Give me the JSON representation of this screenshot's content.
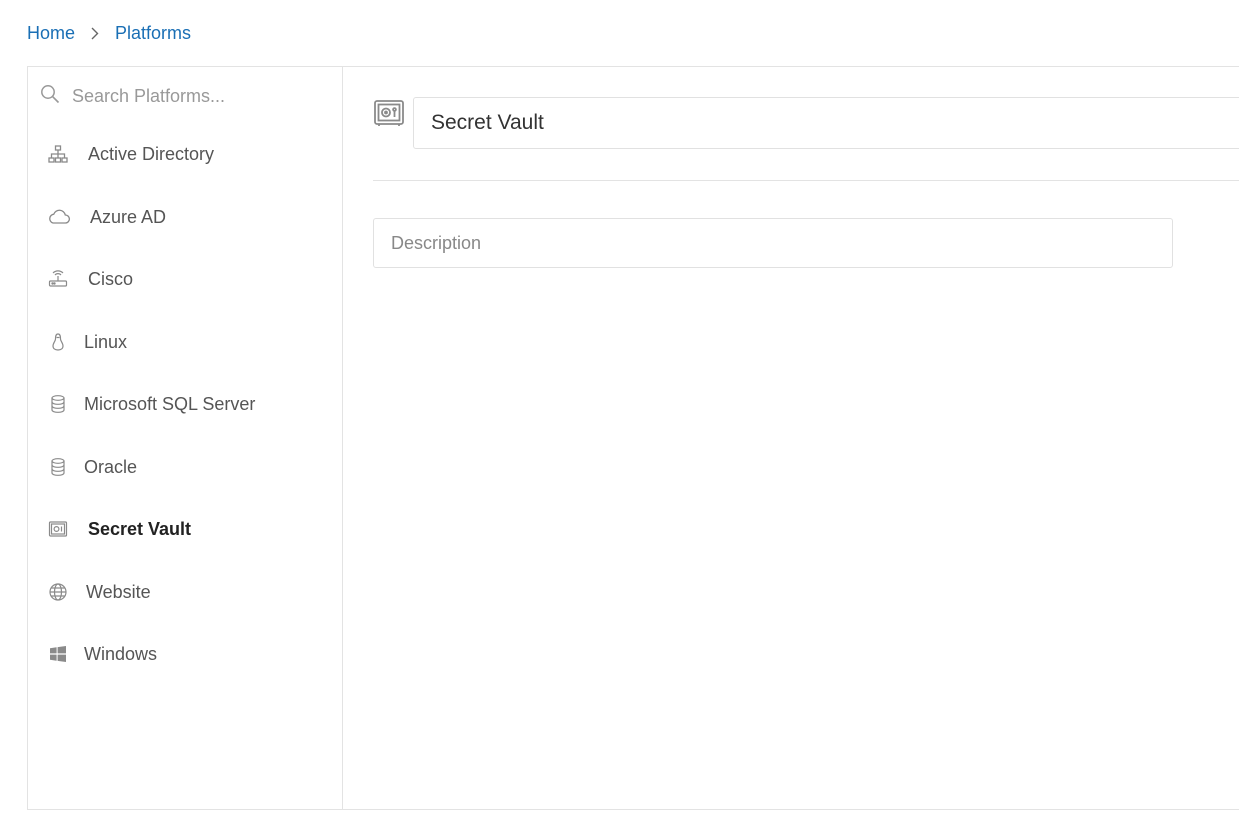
{
  "breadcrumb": {
    "home": "Home",
    "current": "Platforms"
  },
  "sidebar": {
    "search_placeholder": "Search Platforms...",
    "items": [
      {
        "label": "Active Directory",
        "icon": "sitemap-icon"
      },
      {
        "label": "Azure AD",
        "icon": "cloud-icon"
      },
      {
        "label": "Cisco",
        "icon": "router-icon"
      },
      {
        "label": "Linux",
        "icon": "linux-penguin-icon"
      },
      {
        "label": "Microsoft SQL Server",
        "icon": "database-icon"
      },
      {
        "label": "Oracle",
        "icon": "database-icon"
      },
      {
        "label": "Secret Vault",
        "icon": "vault-icon",
        "active": true
      },
      {
        "label": "Website",
        "icon": "globe-icon"
      },
      {
        "label": "Windows",
        "icon": "windows-icon"
      }
    ]
  },
  "editor": {
    "title_value": "Secret Vault",
    "description_placeholder": "Description",
    "description_value": ""
  },
  "colors": {
    "link": "#1a6fb5",
    "border": "#e3e3e3",
    "icon": "#8a8a8a"
  }
}
